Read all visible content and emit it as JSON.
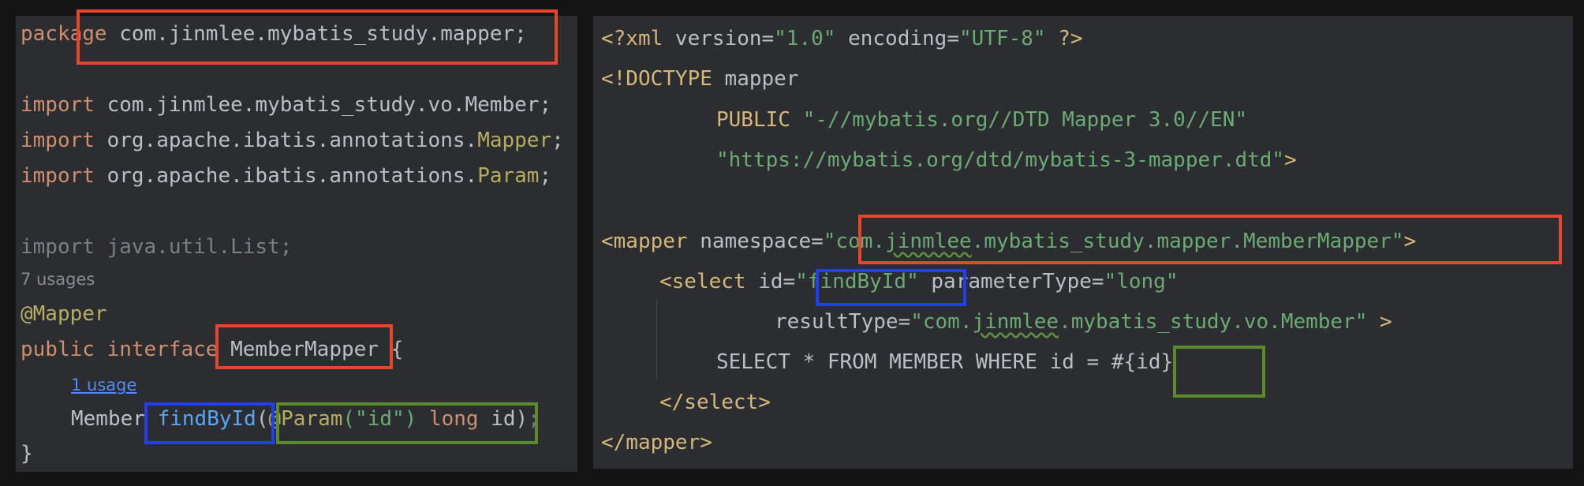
{
  "colors": {
    "highlight_red": "#e8452c",
    "highlight_blue": "#1f3ef5",
    "highlight_green": "#5c8a2e",
    "editor_background": "#2b2d30"
  },
  "java_panel": {
    "line1": {
      "kw": "package",
      "rest": " com.jinmlee.mybatis_study.mapper;"
    },
    "line2": {
      "kw": "import",
      "rest": " com.jinmlee.mybatis_study.vo.Member;"
    },
    "line3": {
      "kw": "import",
      "rest": " org.apache.ibatis.annotations.",
      "cls": "Mapper",
      "end": ";"
    },
    "line4": {
      "kw": "import",
      "rest": " org.apache.ibatis.annotations.",
      "cls": "Param",
      "end": ";"
    },
    "line5": "import java.util.List;",
    "usages": "7 usages",
    "annotation": "@Mapper",
    "line8": {
      "kw": "public interface",
      "name": " MemberMapper",
      "rest": " {"
    },
    "usage_link": "1 usage",
    "line10": {
      "type": "Member ",
      "method": "findById",
      "paren": "(",
      "ann": "@Param",
      "arg": "(\"id\")",
      "kw": " long",
      "rest": " id)",
      "semi": ";"
    },
    "closing": "}"
  },
  "xml_panel": {
    "line1": {
      "open": "<?xml ",
      "attr1": "version",
      "eq1": "=",
      "val1": "\"1.0\"",
      "attr2": " encoding",
      "eq2": "=",
      "val2": "\"UTF-8\"",
      "close": " ?>"
    },
    "line2": {
      "open": "<!DOCTYPE",
      "rest": " mapper"
    },
    "line3": {
      "kw": "PUBLIC",
      "str": " \"-//mybatis.org//DTD Mapper 3.0//EN\""
    },
    "line4": {
      "str": "\"https://mybatis.org/dtd/mybatis-3-mapper.dtd\"",
      "close": ">"
    },
    "line5": {
      "open": "<mapper",
      "attr": " namespace",
      "eq": "=",
      "q1": "\"com.",
      "squig": "jinmlee",
      "q2": ".mybatis_study.mapper.MemberMapper\"",
      "close": ">"
    },
    "line6": {
      "open": "<select",
      "attr1": " id",
      "eq1": "=",
      "val1": "\"findById\"",
      "attr2": " parameterType",
      "eq2": "=",
      "val2": "\"long\""
    },
    "line7": {
      "attr": "resultType",
      "eq": "=",
      "q1": "\"com.",
      "squig": "jinmlee",
      "q2": ".mybatis_study.vo.Member\"",
      "close": " >"
    },
    "line8": {
      "sql": "SELECT * FROM MEMBER WHERE id = ",
      "param": "#{id}"
    },
    "line9": "</select>",
    "line10": "</mapper>"
  }
}
